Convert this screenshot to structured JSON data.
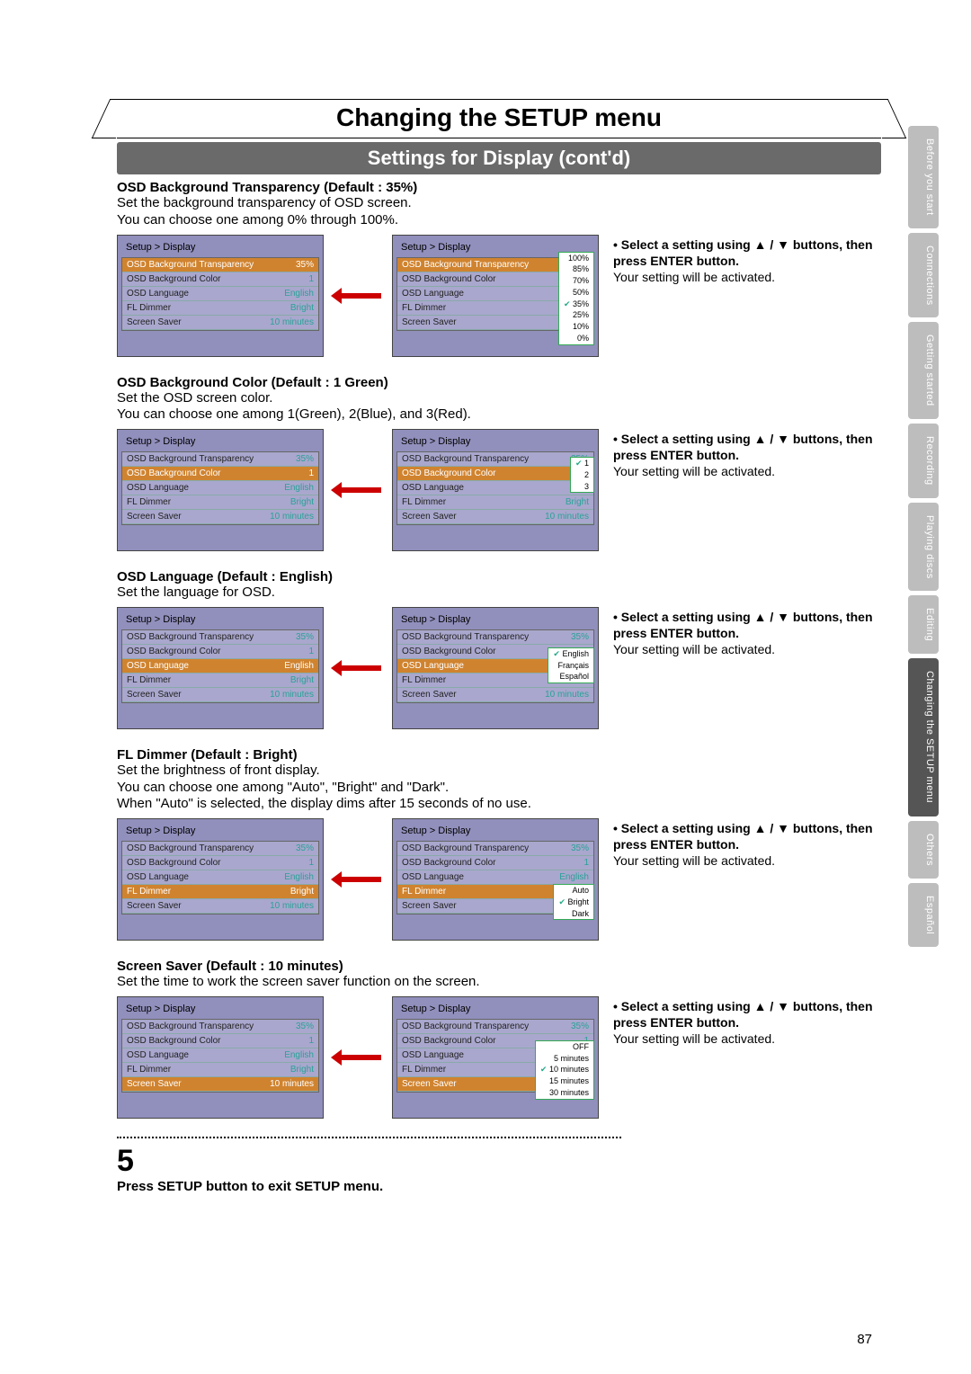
{
  "title": "Changing the SETUP menu",
  "subtitle": "Settings for Display (cont'd)",
  "pageNumber": "87",
  "tabs": [
    "Before you start",
    "Connections",
    "Getting started",
    "Recording",
    "Playing discs",
    "Editing",
    "Changing the SETUP menu",
    "Others",
    "Español"
  ],
  "activeTab": 6,
  "panelCrumb": "Setup > Display",
  "baseItems": {
    "transparency": {
      "label": "OSD Background Transparency",
      "value": "35%"
    },
    "color": {
      "label": "OSD Background Color",
      "value": "1"
    },
    "language": {
      "label": "OSD Language",
      "value": "English"
    },
    "dimmer": {
      "label": "FL Dimmer",
      "value": "Bright"
    },
    "saver": {
      "label": "Screen Saver",
      "value": "10 minutes"
    }
  },
  "instruction": {
    "line1": "• Select a setting using ▲ / ▼ buttons, then press ENTER button.",
    "line2": "Your setting will be activated."
  },
  "sections": {
    "transparency": {
      "title": "OSD Background Transparency (Default : 35%)",
      "desc1": "Set the background transparency of OSD screen.",
      "desc2": "You can choose one among 0% through 100%.",
      "popup": [
        "100%",
        "85%",
        "70%",
        "50%",
        "35%",
        "25%",
        "10%",
        "0%"
      ],
      "checked": "35%"
    },
    "color": {
      "title": "OSD Background Color (Default : 1 Green)",
      "desc1": "Set the OSD screen color.",
      "desc2": "You can choose one among 1(Green), 2(Blue), and 3(Red).",
      "popup": [
        "1",
        "2",
        "3"
      ],
      "checked": "1",
      "rightVal": "Bright",
      "rightSaver": "10 minutes"
    },
    "language": {
      "title": "OSD Language (Default : English)",
      "desc1": "Set the language for OSD.",
      "popup": [
        "English",
        "Français",
        "Español"
      ],
      "checked": "English",
      "rightSaver": "10 minutes"
    },
    "dimmer": {
      "title": "FL Dimmer (Default : Bright)",
      "desc1": "Set the brightness of front display.",
      "desc2": "You can choose one among \"Auto\", \"Bright\" and \"Dark\".",
      "desc3": "When \"Auto\" is selected, the display dims after 15 seconds of no use.",
      "popup": [
        "Auto",
        "Bright",
        "Dark"
      ],
      "checked": "Bright"
    },
    "saver": {
      "title": "Screen Saver (Default : 10 minutes)",
      "desc1": "Set the time to work the screen saver function on the screen.",
      "popup": [
        "OFF",
        "5 minutes",
        "10 minutes",
        "15 minutes",
        "30 minutes"
      ],
      "checked": "10 minutes"
    }
  },
  "step": {
    "num": "5",
    "text": "Press SETUP button to exit SETUP menu."
  }
}
